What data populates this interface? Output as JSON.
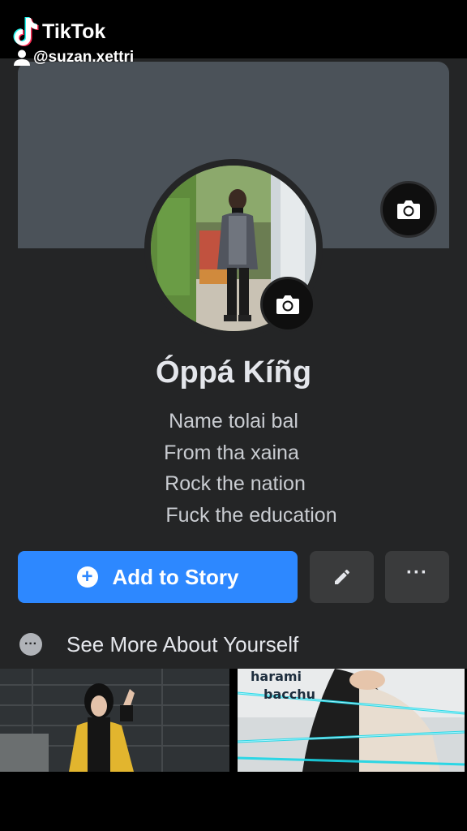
{
  "watermark": {
    "app_name": "TikTok",
    "handle": "@suzan.xettri"
  },
  "profile": {
    "name": "Óppá Kíñg",
    "bio_lines": [
      "Name tolai bal",
      "From tha xaina",
      "Rock the nation",
      "Fuck the education"
    ]
  },
  "actions": {
    "add_to_story_label": "Add to Story",
    "edit_icon": "pencil-icon",
    "more_label": "···"
  },
  "see_more": {
    "label": "See More About Yourself"
  },
  "photos": {
    "right_caption_line1": "harami",
    "right_caption_line2": "bacchu"
  },
  "colors": {
    "accent": "#2d88ff",
    "background": "#242526",
    "cover": "#4b5259"
  }
}
